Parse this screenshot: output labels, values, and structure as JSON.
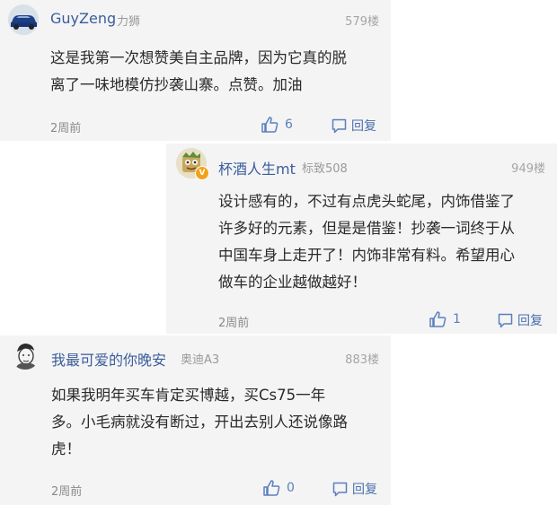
{
  "comments": [
    {
      "username": "GuyZeng",
      "car": "力狮",
      "floor": "579楼",
      "lines": [
        "这是我第一次想赞美自主品牌，因为它真的脱",
        "离了一味地模仿抄袭山寨。点赞。加油"
      ],
      "time": "2周前",
      "likes": "6",
      "reply_label": "回复"
    },
    {
      "username": "杯酒人生mt",
      "car": "标致508",
      "floor": "949楼",
      "badge": "V",
      "lines": [
        "设计感有的，不过有点虎头蛇尾，内饰借鉴了",
        "许多好的元素，但是是借鉴！抄袭一词终于从",
        "中国车身上走开了！内饰非常有料。希望用心",
        "做车的企业越做越好！"
      ],
      "time": "2周前",
      "likes": "1",
      "reply_label": "回复"
    },
    {
      "username": "我最可爱的你晚安",
      "car": "奥迪A3",
      "floor": "883楼",
      "lines": [
        "如果我明年买车肯定买博越，买Cs75一年",
        "多。小毛病就没有断过，开出去别人还说像路",
        "虎！"
      ],
      "time": "2周前",
      "likes": "0",
      "reply_label": "回复"
    }
  ],
  "icons": {
    "like": "thumbs-up-icon",
    "reply": "reply-icon"
  },
  "colors": {
    "username": "#3a5d9c",
    "action": "#5b7fbd",
    "card_bg": "#f4f4f4"
  }
}
